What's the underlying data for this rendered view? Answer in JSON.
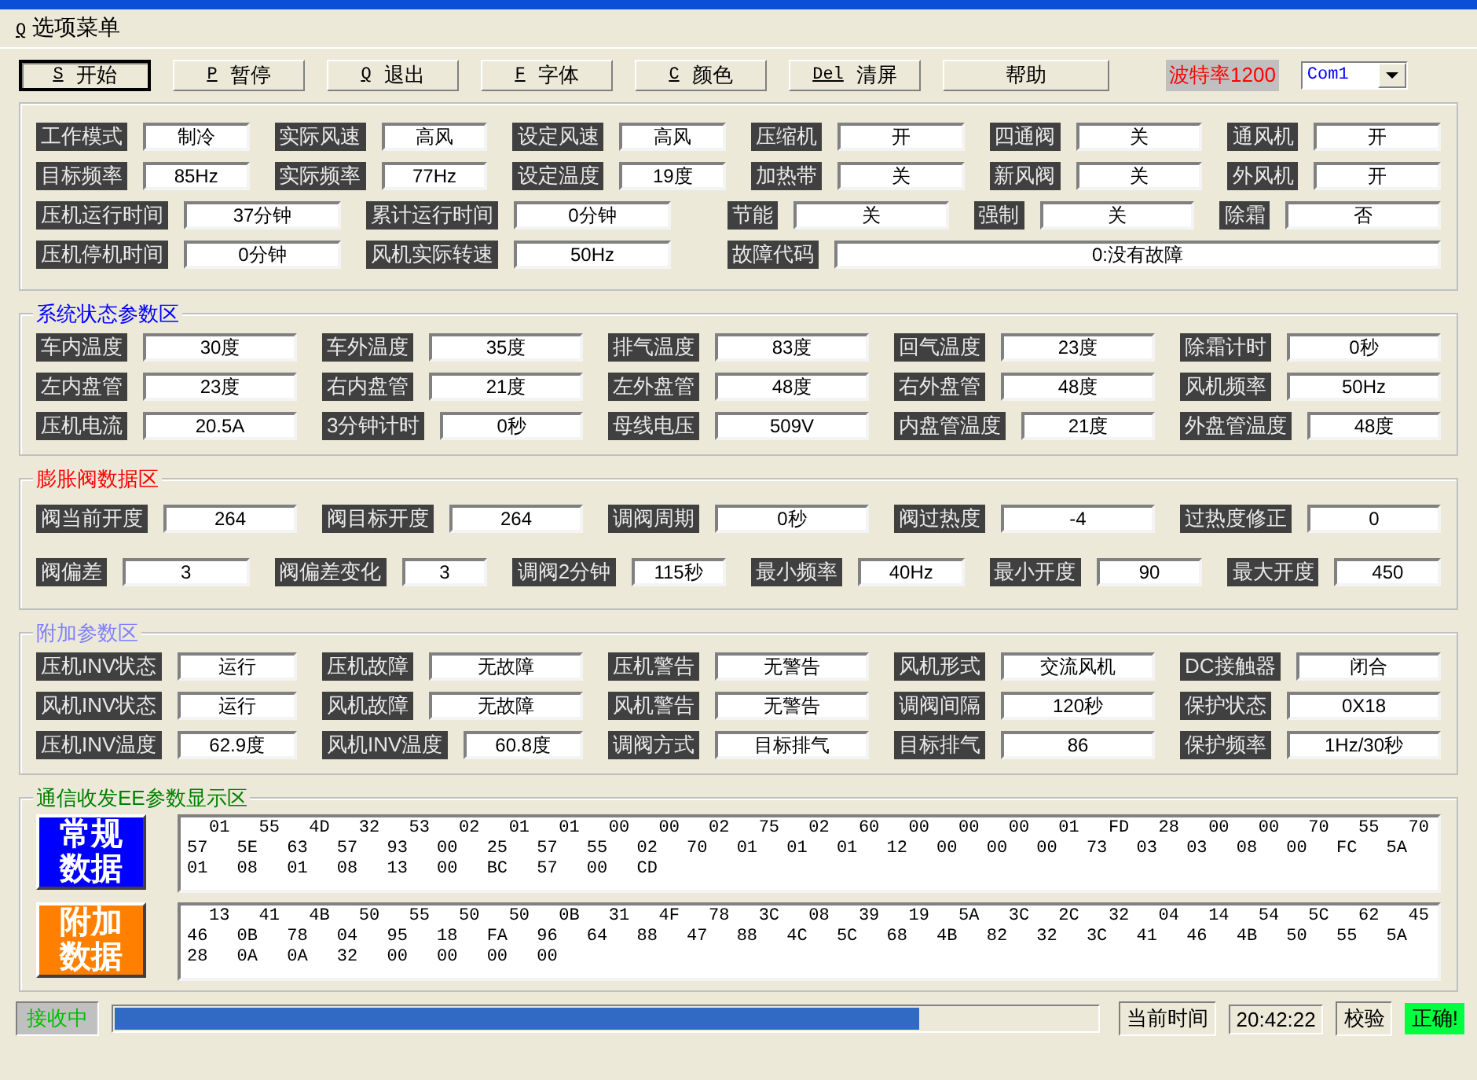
{
  "menu": {
    "key": "Q",
    "label": "选项菜单"
  },
  "toolbar": [
    {
      "key": "S",
      "label": "开始",
      "selected": true
    },
    {
      "key": "P",
      "label": "暂停",
      "selected": false
    },
    {
      "key": "Q",
      "label": "退出",
      "selected": false
    },
    {
      "key": "F",
      "label": "字体",
      "selected": false
    },
    {
      "key": "C",
      "label": "颜色",
      "selected": false
    },
    {
      "key": "Del",
      "label": "清屏",
      "selected": false
    },
    {
      "label": "帮助",
      "selected": false
    }
  ],
  "baud_rate": "波特率1200",
  "port_select": {
    "value": "Com1"
  },
  "main_panel": {
    "rows": [
      {
        "items": [
          {
            "label": "工作模式",
            "value": "制冷"
          },
          {
            "label": "实际风速",
            "value": "高风"
          },
          {
            "label": "设定风速",
            "value": "高风"
          },
          {
            "label": "压缩机",
            "value": "开"
          },
          {
            "label": "四通阀",
            "value": "关"
          },
          {
            "label": "通风机",
            "value": "开"
          }
        ]
      },
      {
        "items": [
          {
            "label": "目标频率",
            "value": "85Hz"
          },
          {
            "label": "实际频率",
            "value": "77Hz"
          },
          {
            "label": "设定温度",
            "value": "19度"
          },
          {
            "label": "加热带",
            "value": "关"
          },
          {
            "label": "新风阀",
            "value": "关"
          },
          {
            "label": "外风机",
            "value": "开"
          }
        ]
      },
      {
        "items": [
          {
            "label": "压机运行时间",
            "value": "37分钟"
          },
          {
            "label": "累计运行时间",
            "value": "0分钟"
          }
        ],
        "right": [
          {
            "label": "节能",
            "value": "关"
          },
          {
            "label": "强制",
            "value": "关"
          },
          {
            "label": "除霜",
            "value": "否"
          }
        ]
      },
      {
        "items": [
          {
            "label": "压机停机时间",
            "value": "0分钟"
          },
          {
            "label": "风机实际转速",
            "value": "50Hz"
          }
        ],
        "right": [
          {
            "label": "故障代码",
            "value": "0:没有故障"
          }
        ]
      }
    ]
  },
  "panels": [
    {
      "title": "系统状态参数区",
      "color": "#0000ff",
      "rows": [
        {
          "items": [
            {
              "label": "车内温度",
              "value": "30度"
            },
            {
              "label": "车外温度",
              "value": "35度"
            },
            {
              "label": "排气温度",
              "value": "83度"
            },
            {
              "label": "回气温度",
              "value": "23度"
            },
            {
              "label": "除霜计时",
              "value": "0秒"
            }
          ]
        },
        {
          "items": [
            {
              "label": "左内盘管",
              "value": "23度"
            },
            {
              "label": "右内盘管",
              "value": "21度"
            },
            {
              "label": "左外盘管",
              "value": "48度"
            },
            {
              "label": "右外盘管",
              "value": "48度"
            },
            {
              "label": "风机频率",
              "value": "50Hz"
            }
          ]
        },
        {
          "items": [
            {
              "label": "压机电流",
              "value": "20.5A"
            },
            {
              "label": "3分钟计时",
              "value": "0秒"
            },
            {
              "label": "母线电压",
              "value": "509V"
            },
            {
              "label": "内盘管温度",
              "value": "21度"
            },
            {
              "label": "外盘管温度",
              "value": "48度"
            }
          ]
        }
      ]
    },
    {
      "title": "膨胀阀数据区",
      "color": "#ff0000",
      "rows": [
        {
          "items": [
            {
              "label": "阀当前开度",
              "value": "264"
            },
            {
              "label": "阀目标开度",
              "value": "264"
            },
            {
              "label": "调阀周期",
              "value": "0秒"
            },
            {
              "label": "阀过热度",
              "value": "-4"
            },
            {
              "label": "过热度修正",
              "value": "0"
            }
          ]
        },
        {
          "items": [
            {
              "label": "阀偏差",
              "value": "3"
            },
            {
              "label": "阀偏差变化",
              "value": "3"
            },
            {
              "label": "调阀2分钟",
              "value": "115秒"
            },
            {
              "label": "最小频率",
              "value": "40Hz"
            },
            {
              "label": "最小开度",
              "value": "90"
            },
            {
              "label": "最大开度",
              "value": "450"
            }
          ]
        }
      ]
    },
    {
      "title": "附加参数区",
      "color": "#8080ff",
      "rows": [
        {
          "items": [
            {
              "label": "压机INV状态",
              "value": "运行"
            },
            {
              "label": "压机故障",
              "value": "无故障"
            },
            {
              "label": "压机警告",
              "value": "无警告"
            },
            {
              "label": "风机形式",
              "value": "交流风机"
            },
            {
              "label": "DC接触器",
              "value": "闭合"
            }
          ]
        },
        {
          "items": [
            {
              "label": "风机INV状态",
              "value": "运行"
            },
            {
              "label": "风机故障",
              "value": "无故障"
            },
            {
              "label": "风机警告",
              "value": "无警告"
            },
            {
              "label": "调阀间隔",
              "value": "120秒"
            },
            {
              "label": "保护状态",
              "value": "0X18"
            }
          ]
        },
        {
          "items": [
            {
              "label": "压机INV温度",
              "value": "62.9度"
            },
            {
              "label": "风机INV温度",
              "value": "60.8度"
            },
            {
              "label": "调阀方式",
              "value": "目标排气"
            },
            {
              "label": "目标排气",
              "value": "86"
            },
            {
              "label": "保护频率",
              "value": "1Hz/30秒"
            }
          ]
        }
      ]
    }
  ],
  "comm_panel": {
    "title": "通信收发EE参数显示区",
    "color": "#008000",
    "blocks": [
      {
        "label": "常规数据",
        "color": "#0000ff",
        "lines": [
          "01 55 4D 32 53 02 01 01 00 00 02 75 02 60 00 00 00 01 FD 28 00 00 70 55 70",
          "57 5E 63 57 93 00 25 57 55 02 70 01 01 01 12 00 00 00 73 03 03 08 00 FC 5A",
          "01 08 01 08 13 00 BC 57 00 CD"
        ]
      },
      {
        "label": "附加数据",
        "color": "#ff8000",
        "lines": [
          "13 41 4B 50 55 50 50 0B 31 4F 78 3C 08 39 19 5A 3C 2C 32 04 14 54 5C 62 45",
          "46 0B 78 04 95 18 FA 96 64 88 47 88 4C 5C 68 4B 82 32 3C 41 46 4B 50 55 5A",
          "28 0A 0A 32 00 00 00 00"
        ]
      }
    ]
  },
  "status_bar": {
    "receive_state": "接收中",
    "progress": {
      "level": 0.82
    },
    "time_label": "当前时间",
    "time": "20:42:22",
    "check_label": "校验",
    "check_result": "正确!"
  }
}
